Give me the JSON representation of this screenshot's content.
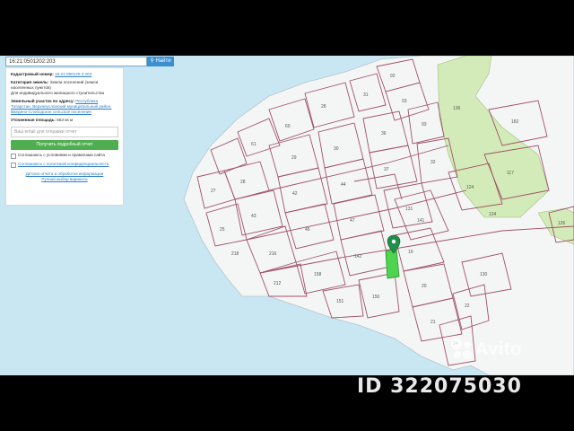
{
  "search": {
    "value": "16:21:0501202:203",
    "button_label": "Найти"
  },
  "info_panel": {
    "cadastral_label": "Кадастровый номер:",
    "cadastral_value": "16:21:050120:2:203",
    "category_label": "Категория земель:",
    "category_value": "Земли поселений (земли населенных пунктов)",
    "use_value": "Для индивидуального жилищного строительства",
    "address_label": "Земельный участок по адресу:",
    "address_value": "Республика Татарстан, Верхнеуслонский муниципальный район, Введено-Слободское сельское поселение",
    "area_label": "Уточненная площадь:",
    "area_value": "563 кв м",
    "object_placeholder": "Ваш email для отправки отчет",
    "report_button": "Получить подробный отчет",
    "consent_1": "Соглашаюсь с условиями и правилами сайта",
    "consent_2": "Соглашаюсь с политикой конфиденциальности",
    "footer_link_1": "Детали отчета и обработка информации",
    "footer_link_2": "Ручной выбор варианта"
  },
  "parcels": {
    "selected_color": "#4fd44f",
    "boundary_color": "#a0506a",
    "land_color": "#f4f6f6",
    "forest_color": "#d3ebb8",
    "water_color": "#c9e6f3",
    "labels": [
      "92",
      "93",
      "31",
      "28",
      "60",
      "61",
      "93",
      "27",
      "28",
      "29",
      "30",
      "36",
      "37",
      "32",
      "44",
      "42",
      "43",
      "25",
      "46",
      "47",
      "131",
      "141",
      "142",
      "158",
      "216",
      "212",
      "218",
      "19",
      "20",
      "21",
      "22",
      "24",
      "150",
      "151",
      "182",
      "117",
      "124",
      "126",
      "130",
      "134",
      "136"
    ]
  },
  "pin_icon": "map-pin-icon",
  "watermarks": {
    "avito": "Avito",
    "id": "ID 322075030"
  }
}
